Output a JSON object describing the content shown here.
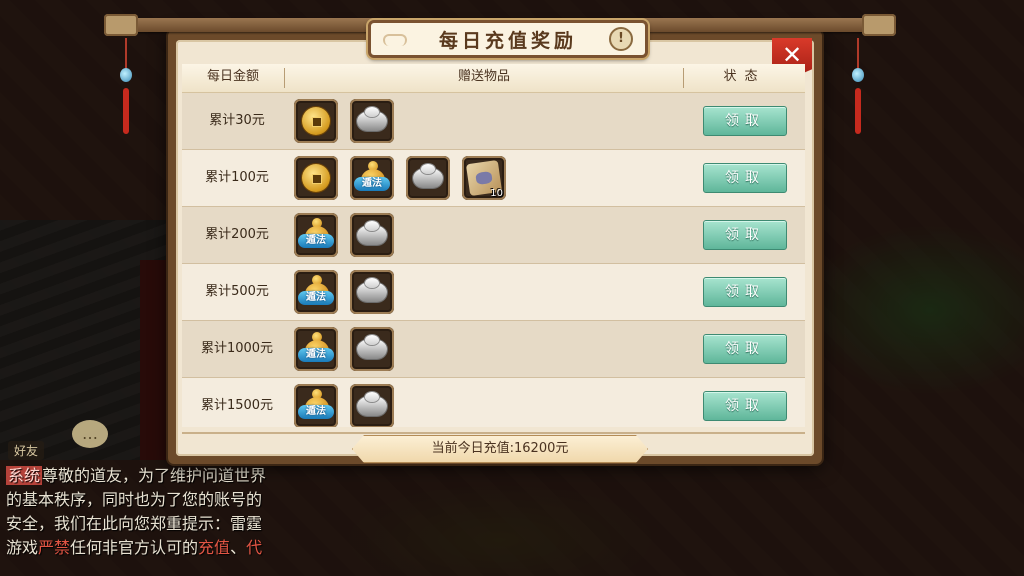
{
  "dialog": {
    "title": "每日充值奖励",
    "info_symbol": "!",
    "close_symbol": "✕"
  },
  "table": {
    "headers": [
      "每日金额",
      "赠送物品",
      "状态"
    ],
    "rows": [
      {
        "amount": "累计30元",
        "items": [
          "coin",
          "silver-ingot"
        ],
        "button": "领取"
      },
      {
        "amount": "累计100元",
        "items": [
          "coin",
          "gourd",
          "silver-ingot",
          "scroll"
        ],
        "scroll_qty": "10",
        "button": "领取"
      },
      {
        "amount": "累计200元",
        "items": [
          "gourd",
          "silver-ingot"
        ],
        "button": "领取"
      },
      {
        "amount": "累计500元",
        "items": [
          "gourd",
          "silver-ingot"
        ],
        "button": "领取"
      },
      {
        "amount": "累计1000元",
        "items": [
          "gourd",
          "silver-ingot"
        ],
        "button": "领取"
      },
      {
        "amount": "累计1500元",
        "items": [
          "gourd",
          "silver-ingot"
        ],
        "button": "领取"
      }
    ],
    "gourd_label": "遁法"
  },
  "footer": {
    "current_recharge": "当前今日充值:16200元"
  },
  "chat": {
    "tab": "好友",
    "tag": "系统",
    "line1": "尊敬的道友，为了维护问道世界",
    "line2": "的基本秩序，同时也为了您的账号的",
    "line3": "安全，我们在此向您郑重提示：雷霆",
    "line4_a": "游戏",
    "line4_b": "严禁",
    "line4_c": "任何非官方认可的",
    "line4_d": "充值",
    "line4_e": "、",
    "line4_f": "代"
  },
  "colors": {
    "claim_button": "#5fb69a",
    "close_button": "#c22a1e",
    "frame": "#6c4a2a"
  }
}
